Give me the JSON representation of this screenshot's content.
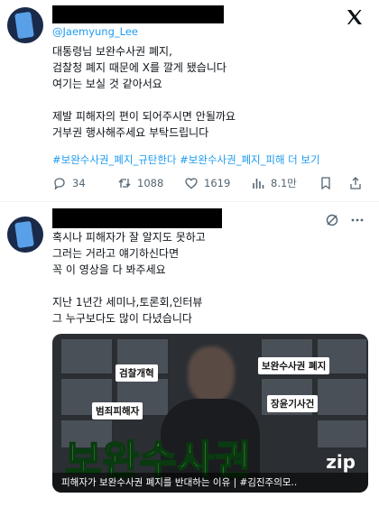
{
  "tweet1": {
    "handle": "@Jaemyung_Lee",
    "lines": [
      "대통령님 보완수사권 폐지,",
      "검찰청 폐지 때문에 X를 깔게 됐습니다",
      "여기는 보실 것 같아서요",
      "",
      "제발 피해자의 편이 되어주시면 안될까요",
      "거부권 행사해주세요 부탁드립니다"
    ],
    "hashtags": "#보완수사권_폐지_규탄한다 #보완수사권_폐지_피해 더 보기",
    "actions": {
      "replies": "34",
      "retweets": "1088",
      "likes": "1619",
      "views": "8.1만"
    }
  },
  "tweet2": {
    "lines": [
      "혹시나 피해자가 잘 알지도 못하고",
      "그러는 거라고 얘기하신다면",
      "꼭 이 영상을 다 봐주세요",
      "",
      "지난 1년간 세미나,토론회,인터뷰",
      "그 누구보다도 많이 다녔습니다"
    ],
    "video": {
      "labels": {
        "prosecution_reform": "검찰개혁",
        "supplementary_abolition": "보완수사권 폐지",
        "long_term_case": "장윤기사건",
        "crime_victim": "범죄피해자"
      },
      "big_title": "보완수사권",
      "caption": "피해자가 보완수사권 폐지를 반대하는 이유  |  #김진주의모..",
      "watermark": "zip"
    }
  },
  "icons": {
    "x_logo": "x-logo-icon",
    "reply": "reply-icon",
    "retweet": "retweet-icon",
    "like": "heart-icon",
    "views": "views-icon",
    "bookmark": "bookmark-icon",
    "share": "share-icon"
  },
  "colors": {
    "link": "#1d9bf0",
    "text": "#0f1419",
    "muted": "#536471",
    "title_green": "#7df06a"
  }
}
